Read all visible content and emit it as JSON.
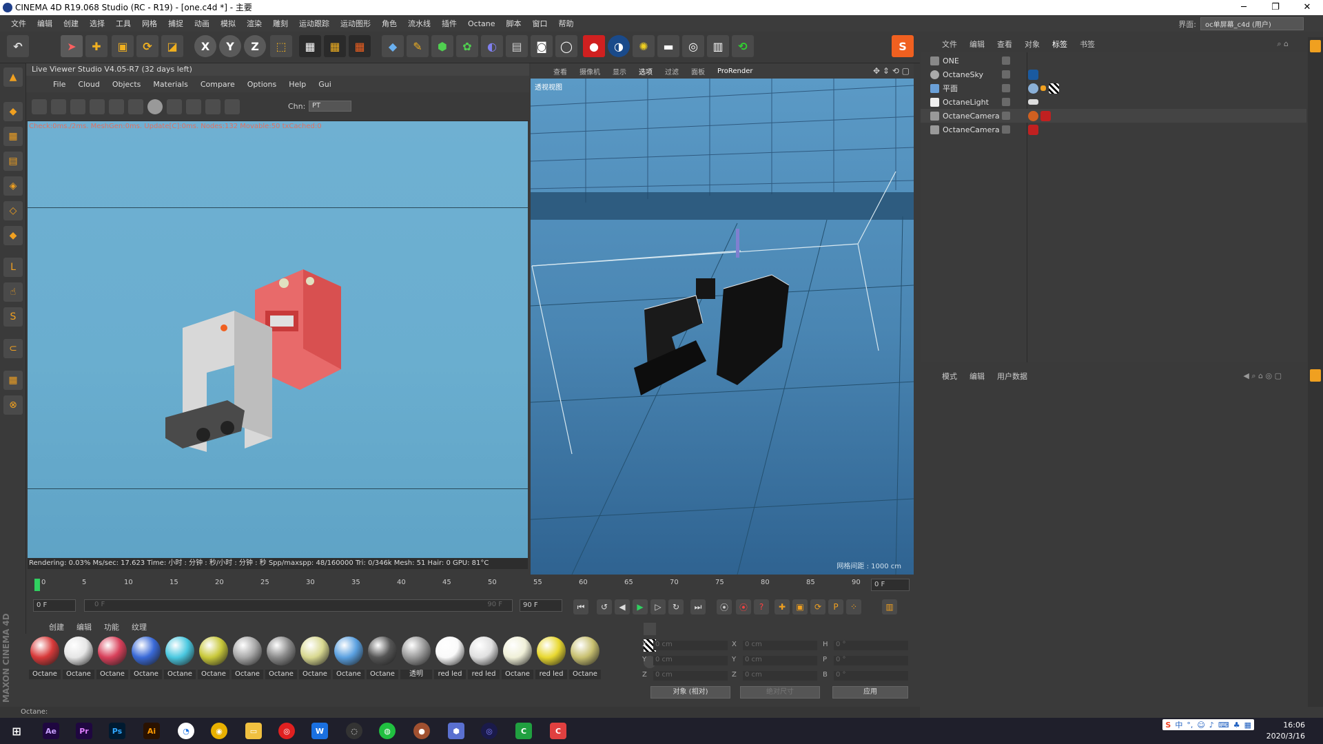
{
  "window": {
    "title": "CINEMA 4D R19.068 Studio (RC - R19) - [one.c4d *] - 主要",
    "min": "─",
    "max": "❐",
    "close": "✕"
  },
  "menubar": {
    "items": [
      "文件",
      "编辑",
      "创建",
      "选择",
      "工具",
      "网格",
      "捕捉",
      "动画",
      "模拟",
      "渲染",
      "雕刻",
      "运动跟踪",
      "运动图形",
      "角色",
      "流水线",
      "插件",
      "Octane",
      "脚本",
      "窗口",
      "帮助"
    ],
    "interface_label": "界面:",
    "interface_value": "oc单屏幕_c4d (用户)"
  },
  "live_viewer": {
    "title": "Live Viewer Studio V4.05-R7 (32 days left)",
    "menu": [
      "File",
      "Cloud",
      "Objects",
      "Materials",
      "Compare",
      "Options",
      "Help",
      "Gui"
    ],
    "chn_label": "Chn:",
    "chn_value": "PT",
    "info": "Check:0ms./2ms. MeshGen:0ms. Update[C]:0ms. Nodes:132 Movable:50 txCached:0",
    "status": "Rendering: 0.03%   Ms/sec: 17.623   Time: 小时 : 分钟 : 秒/小时 : 分钟 : 秒   Spp/maxspp: 48/160000   Tri: 0/346k   Mesh: 51   Hair: 0   GPU:    81°C"
  },
  "viewport": {
    "menu": [
      "查看",
      "摄像机",
      "显示",
      "选项",
      "过滤",
      "面板"
    ],
    "prorender": "ProRender",
    "label": "透视视图",
    "grid": "网格间距 : 1000 cm"
  },
  "object_manager": {
    "menu": [
      "文件",
      "编辑",
      "查看",
      "对象",
      "标签",
      "书签"
    ],
    "objects": [
      {
        "name": "ONE",
        "icon": "layer-icon"
      },
      {
        "name": "OctaneSky",
        "icon": "sky-icon"
      },
      {
        "name": "平面",
        "icon": "plane-icon"
      },
      {
        "name": "OctaneLight",
        "icon": "light-icon"
      },
      {
        "name": "OctaneCamera",
        "icon": "camera-icon"
      },
      {
        "name": "OctaneCamera",
        "icon": "camera-icon"
      }
    ]
  },
  "attribute_manager": {
    "menu": [
      "模式",
      "编辑",
      "用户数据"
    ]
  },
  "timeline": {
    "ticks": [
      "0",
      "5",
      "10",
      "15",
      "20",
      "25",
      "30",
      "35",
      "40",
      "45",
      "50",
      "55",
      "60",
      "65",
      "70",
      "75",
      "80",
      "85",
      "90"
    ],
    "frame_end_field": "0 F",
    "current_frame": "0 F",
    "range_start": "0 F",
    "range_end": "90 F",
    "max_frame": "90 F"
  },
  "materials": {
    "menu": [
      "创建",
      "编辑",
      "功能",
      "纹理"
    ],
    "items": [
      {
        "label": "Octane",
        "color": "#d83a3a"
      },
      {
        "label": "Octane",
        "color": "#e6e6e6"
      },
      {
        "label": "Octane",
        "color": "#d8405a"
      },
      {
        "label": "Octane",
        "color": "#3a6ad8"
      },
      {
        "label": "Octane",
        "color": "#4ac8e0"
      },
      {
        "label": "Octane",
        "color": "#c8c83a"
      },
      {
        "label": "Octane",
        "color": "#a8a8a8"
      },
      {
        "label": "Octane",
        "color": "#8a8a8a"
      },
      {
        "label": "Octane",
        "color": "#d8d890"
      },
      {
        "label": "Octane",
        "color": "#5aa0e0"
      },
      {
        "label": "Octane",
        "color": "#555555"
      },
      {
        "label": "透明",
        "color": "#9a9a9a"
      },
      {
        "label": "red led",
        "color": "#fafafa"
      },
      {
        "label": "red led",
        "color": "#e0e0e0"
      },
      {
        "label": "Octane",
        "color": "#f0f0d8"
      },
      {
        "label": "red led",
        "color": "#e8d830"
      },
      {
        "label": "Octane",
        "color": "#c8c070"
      }
    ]
  },
  "coordinates": {
    "x": "X",
    "y": "Y",
    "z": "Z",
    "x_val": "0 cm",
    "y_val": "0 cm",
    "z_val": "0 cm",
    "sx_val": "0 cm",
    "sy_val": "0 cm",
    "sz_val": "0 cm",
    "h": "H",
    "p": "P",
    "b": "B",
    "h_val": "0 °",
    "p_val": "0 °",
    "b_val": "0 °",
    "mode": "对象 (相对)",
    "size_mode": "绝对尺寸",
    "apply": "应用"
  },
  "status": {
    "text": "Octane:"
  },
  "branding": {
    "maxon": "MAXON CINEMA 4D"
  },
  "taskbar": {
    "apps": [
      "Ae",
      "Pr",
      "Ps",
      "Ai"
    ],
    "ime": "中",
    "time": "16:06",
    "date": "2020/3/16"
  }
}
